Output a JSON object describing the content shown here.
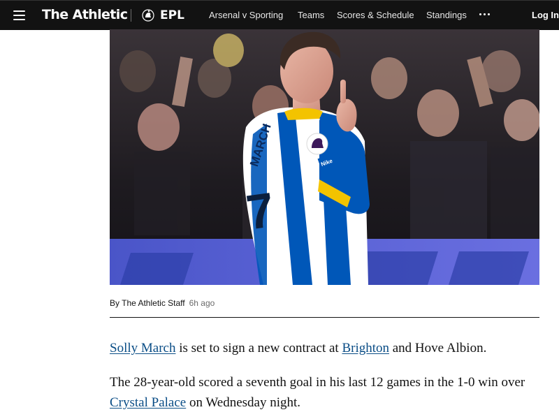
{
  "nav": {
    "brand": "The Athletic",
    "league": "EPL",
    "items": [
      {
        "label": "Arsenal v Sporting"
      },
      {
        "label": "Teams"
      },
      {
        "label": "Scores & Schedule"
      },
      {
        "label": "Standings"
      }
    ],
    "more_icon": "ellipsis-icon",
    "login": "Log In"
  },
  "hero": {
    "shirt_name": "MARCH",
    "shirt_number": "7",
    "sponsor_text": "Nike"
  },
  "byline": {
    "author": "By The Athletic Staff",
    "time": "6h ago"
  },
  "article": {
    "p1": {
      "link1": "Solly March",
      "text1": " is set to sign a new contract at ",
      "link2": "Brighton",
      "text2": " and Hove Albion."
    },
    "p2": {
      "text1": "The 28-year-old scored a seventh goal in his last 12 games in the 1-0 win over ",
      "link1": "Crystal Palace",
      "text2": " on Wednesday night."
    }
  },
  "colors": {
    "nav_bg": "#121212",
    "link": "#0a4d86",
    "brighton_blue": "#0057b8"
  }
}
